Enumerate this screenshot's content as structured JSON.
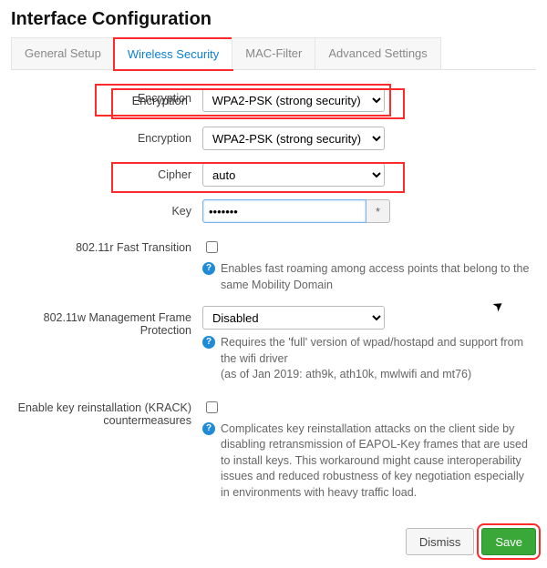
{
  "title": "Interface Configuration",
  "tabs": {
    "general": "General Setup",
    "wireless": "Wireless Security",
    "mac": "MAC-Filter",
    "advanced": "Advanced Settings"
  },
  "labels": {
    "encryption": "Encryption",
    "cipher": "Cipher",
    "key": "Key",
    "ft": "802.11r Fast Transition",
    "mfp": "802.11w Management Frame Protection",
    "krack": "Enable key reinstallation (KRACK) countermeasures"
  },
  "values": {
    "encryption": "WPA2-PSK (strong security)",
    "cipher": "auto",
    "key": "•••••••",
    "mfp": "Disabled"
  },
  "reveal_glyph": "*",
  "help": {
    "ft": "Enables fast roaming among access points that belong to the same Mobility Domain",
    "mfp1": "Requires the 'full' version of wpad/hostapd and support from the wifi driver",
    "mfp2": "(as of Jan 2019: ath9k, ath10k, mwlwifi and mt76)",
    "krack": "Complicates key reinstallation attacks on the client side by disabling retransmission of EAPOL-Key frames that are used to install keys. This workaround might cause interoperability issues and reduced robustness of key negotiation especially in environments with heavy traffic load."
  },
  "info_glyph": "?",
  "buttons": {
    "dismiss": "Dismiss",
    "save": "Save"
  }
}
